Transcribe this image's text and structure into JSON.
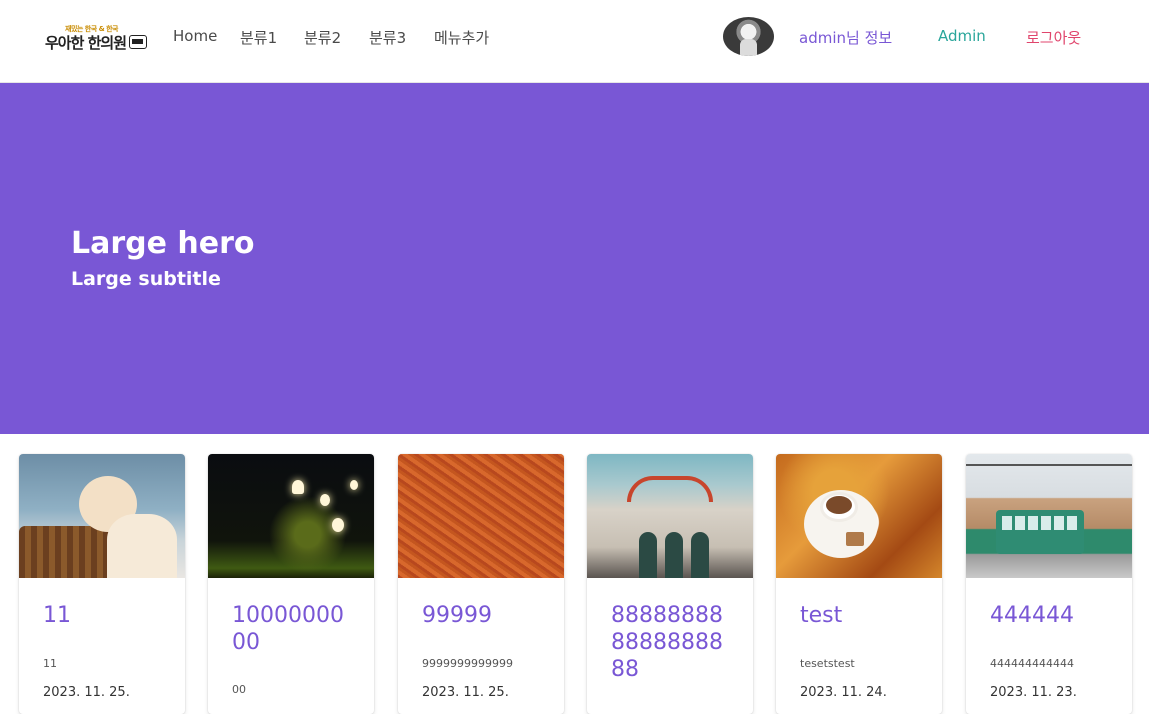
{
  "navbar": {
    "logo_top": "재밌는 한국 & 한국",
    "logo_main": "우아한 한의원",
    "menu": [
      "Home",
      "분류1",
      "분류2",
      "분류3",
      "메뉴추가"
    ],
    "user_info": "admin님 정보",
    "admin": "Admin",
    "logout": "로그아웃",
    "colors": {
      "user_info": "#7957d5",
      "admin": "#2aa69b",
      "logout": "#e0456c"
    }
  },
  "hero": {
    "title": "Large hero",
    "subtitle": "Large subtitle",
    "background": "#7957d5"
  },
  "cards": [
    {
      "title": "11",
      "desc": "11",
      "date": "2023. 11. 25."
    },
    {
      "title": "1000000000",
      "desc": "00",
      "date": ""
    },
    {
      "title": "99999",
      "desc": "9999999999999",
      "date": "2023. 11. 25."
    },
    {
      "title": "888888888888888888",
      "desc": "",
      "date": ""
    },
    {
      "title": "test",
      "desc": "tesetstest",
      "date": "2023. 11. 24."
    },
    {
      "title": "444444",
      "desc": "444444444444",
      "date": "2023. 11. 23."
    }
  ]
}
